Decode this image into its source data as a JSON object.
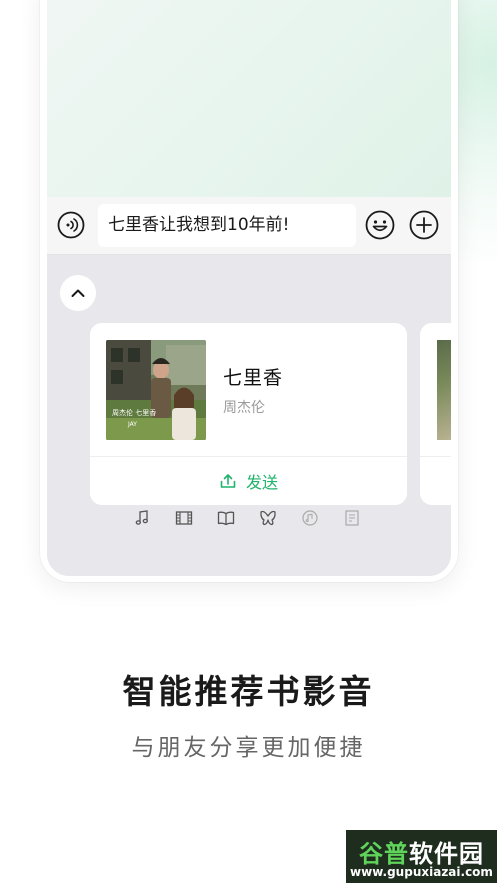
{
  "input": {
    "text": "七里香让我想到10年前!"
  },
  "music_card": {
    "title": "七里香",
    "artist": "周杰伦",
    "send_label": "发送"
  },
  "share_tabs": [
    "music-note-icon",
    "film-icon",
    "book-icon",
    "butterfly-icon",
    "disc-icon",
    "document-icon"
  ],
  "promo": {
    "headline": "智能推荐书影音",
    "subline": "与朋友分享更加便捷"
  },
  "watermark": {
    "name_green": "谷普",
    "name_white": "软件园",
    "url": "www.gupuxiazai.com"
  },
  "colors": {
    "accent": "#1fb36b",
    "panel_bg": "#e8e8ec",
    "watermark_bg": "#1f2d1f"
  }
}
